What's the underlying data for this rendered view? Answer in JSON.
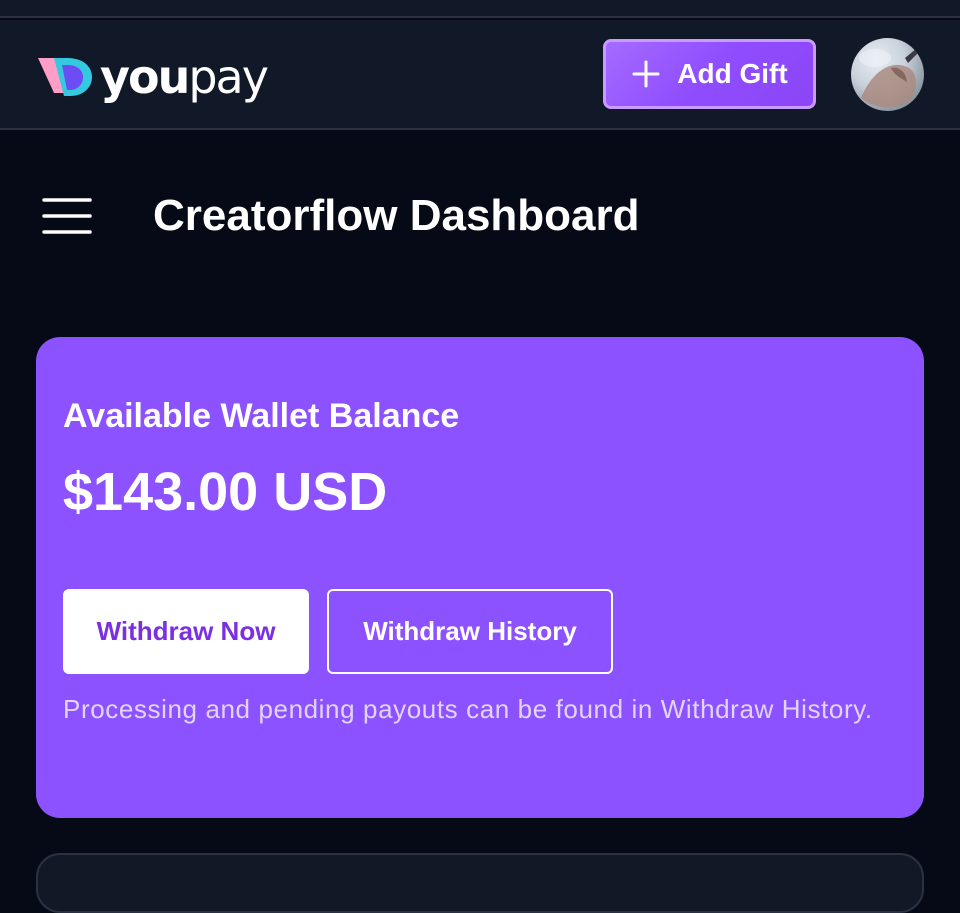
{
  "brand": {
    "logo_you": "you",
    "logo_pay": "pay",
    "colors": {
      "mark_pink": "#ff9ec7",
      "mark_teal": "#35c9e0",
      "mark_violet": "#6b4cf5"
    }
  },
  "header": {
    "add_gift_label": "Add Gift",
    "add_gift_icon": "plus-icon",
    "avatar_icon": "user-avatar"
  },
  "page": {
    "menu_icon": "hamburger-menu-icon",
    "title": "Creatorflow Dashboard"
  },
  "wallet": {
    "label": "Available Wallet Balance",
    "amount": "$143.00 USD",
    "withdraw_now_label": "Withdraw Now",
    "withdraw_history_label": "Withdraw History",
    "note": "Processing and pending payouts can be found in Withdraw History.",
    "card_color": "#8c52ff"
  }
}
